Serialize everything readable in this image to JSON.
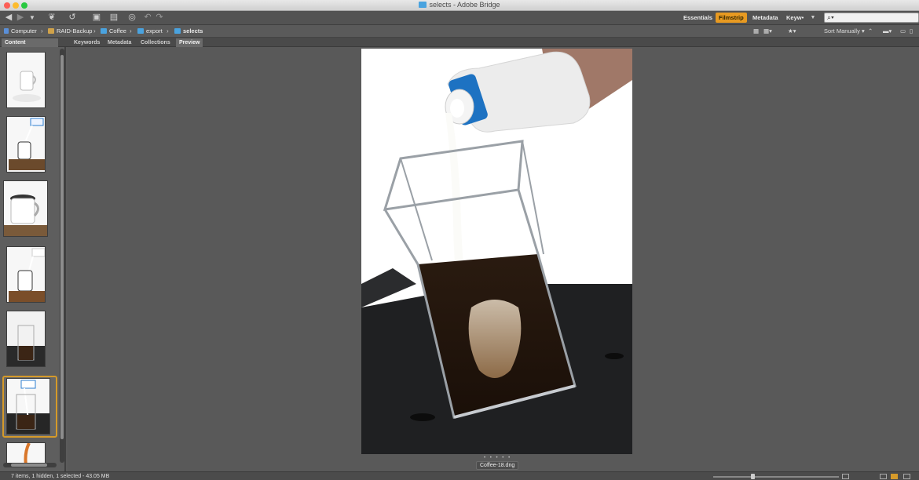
{
  "window": {
    "title": "selects - Adobe Bridge"
  },
  "toolbar": {
    "workspaces": [
      "Essentials",
      "Filmstrip",
      "Metadata",
      "Keyw•"
    ],
    "active_workspace": "Filmstrip",
    "search_placeholder": "⌕▾"
  },
  "path": {
    "crumbs": [
      "Computer",
      "RAID-Backup",
      "Coffee",
      "export",
      "selects"
    ],
    "sort_label": "Sort Manually"
  },
  "panels": {
    "tabs": [
      "Content",
      "Keywords",
      "Metadata",
      "Collections",
      "Preview"
    ],
    "active_tab": "Preview"
  },
  "content": {
    "thumbnail_count": 7,
    "selected_index": 5
  },
  "preview": {
    "filename": "Coffee-18.dng",
    "rating_stars": "• • • • •"
  },
  "status": {
    "text": "7 items, 1 hidden, 1 selected - 43.05 MB"
  },
  "colors": {
    "accent": "#e89a21",
    "folder": "#4aa3df",
    "selection": "#d59a2a"
  }
}
